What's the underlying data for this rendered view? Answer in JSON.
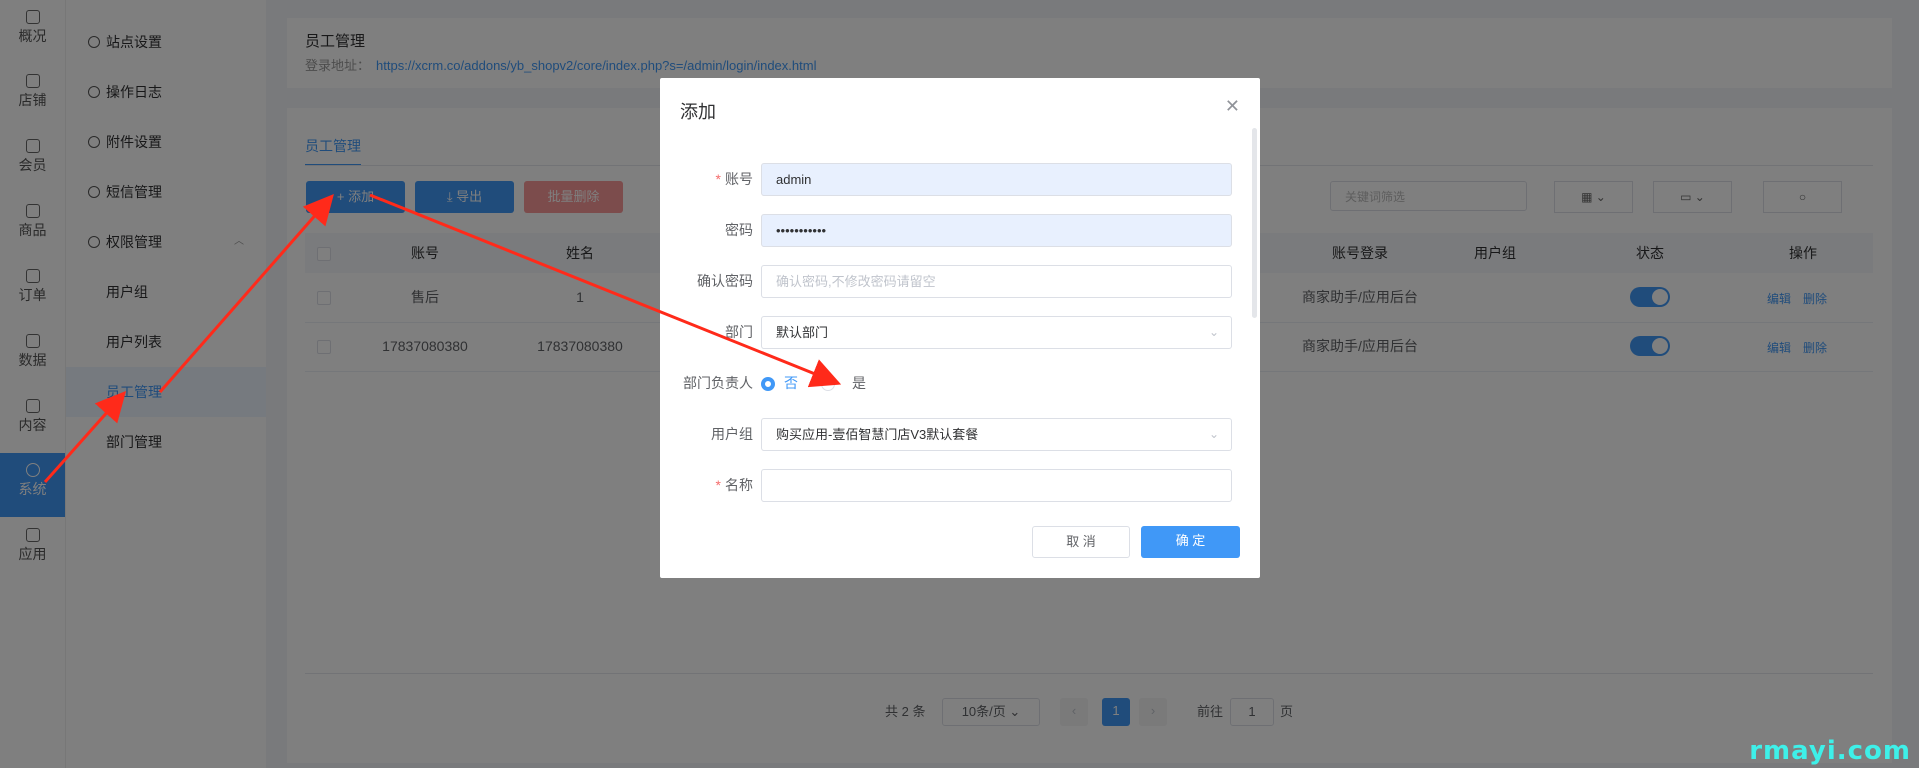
{
  "rail": {
    "items": [
      {
        "label": "概况",
        "icon": "dashboard-icon"
      },
      {
        "label": "店铺",
        "icon": "store-icon"
      },
      {
        "label": "会员",
        "icon": "user-icon"
      },
      {
        "label": "商品",
        "icon": "box-icon"
      },
      {
        "label": "订单",
        "icon": "order-icon"
      },
      {
        "label": "数据",
        "icon": "chart-icon"
      },
      {
        "label": "内容",
        "icon": "folder-icon"
      },
      {
        "label": "系统",
        "icon": "gear-icon"
      },
      {
        "label": "应用",
        "icon": "cube-icon"
      }
    ]
  },
  "subnav": {
    "top_label": "系统",
    "items": [
      {
        "label": "站点设置"
      },
      {
        "label": "操作日志"
      },
      {
        "label": "附件设置"
      },
      {
        "label": "短信管理"
      },
      {
        "label": "权限管理"
      },
      {
        "label": "用户组"
      },
      {
        "label": "用户列表"
      },
      {
        "label": "员工管理"
      },
      {
        "label": "部门管理"
      }
    ]
  },
  "header": {
    "title": "员工管理",
    "login_label": "登录地址：",
    "login_url": "https://xcrm.co/addons/yb_shopv2/core/index.php?s=/admin/login/index.html"
  },
  "tabs": {
    "active": "员工管理"
  },
  "toolbar": {
    "add": "+ 添加",
    "export": "⤓ 导出",
    "batch_delete": "批量删除",
    "keyword_placeholder": "关键词筛选"
  },
  "table": {
    "columns": [
      "账号",
      "姓名",
      "账号登录",
      "用户组",
      "状态",
      "操作"
    ],
    "rows": [
      {
        "account": "售后",
        "name": "1",
        "login": "商家助手/应用后台",
        "group": "",
        "status": true,
        "edit": "编辑",
        "delete": "删除"
      },
      {
        "account": "17837080380",
        "name": "17837080380",
        "login": "商家助手/应用后台",
        "group": "",
        "status": true,
        "edit": "编辑",
        "delete": "删除"
      }
    ]
  },
  "pagination": {
    "total": "共 2 条",
    "page_size": "10条/页",
    "current": "1",
    "goto_label": "前往",
    "goto_value": "1",
    "page_suffix": "页"
  },
  "dialog": {
    "title": "添加",
    "fields": {
      "account": {
        "label": "账号",
        "value": "admin"
      },
      "password": {
        "label": "密码",
        "value": "•••••••••••"
      },
      "confirm": {
        "label": "确认密码",
        "placeholder": "确认密码,不修改密码请留空"
      },
      "department": {
        "label": "部门",
        "value": "默认部门"
      },
      "head": {
        "label": "部门负责人",
        "no": "否",
        "yes": "是",
        "selected": "否"
      },
      "group": {
        "label": "用户组",
        "value": "购买应用-壹佰智慧门店V3默认套餐"
      },
      "name": {
        "label": "名称",
        "value": ""
      }
    },
    "cancel": "取 消",
    "ok": "确 定"
  },
  "watermark": "rmayi.com",
  "colors": {
    "primary": "#4098f7",
    "danger": "#f56c6c",
    "annotation": "#ff2a1a"
  }
}
